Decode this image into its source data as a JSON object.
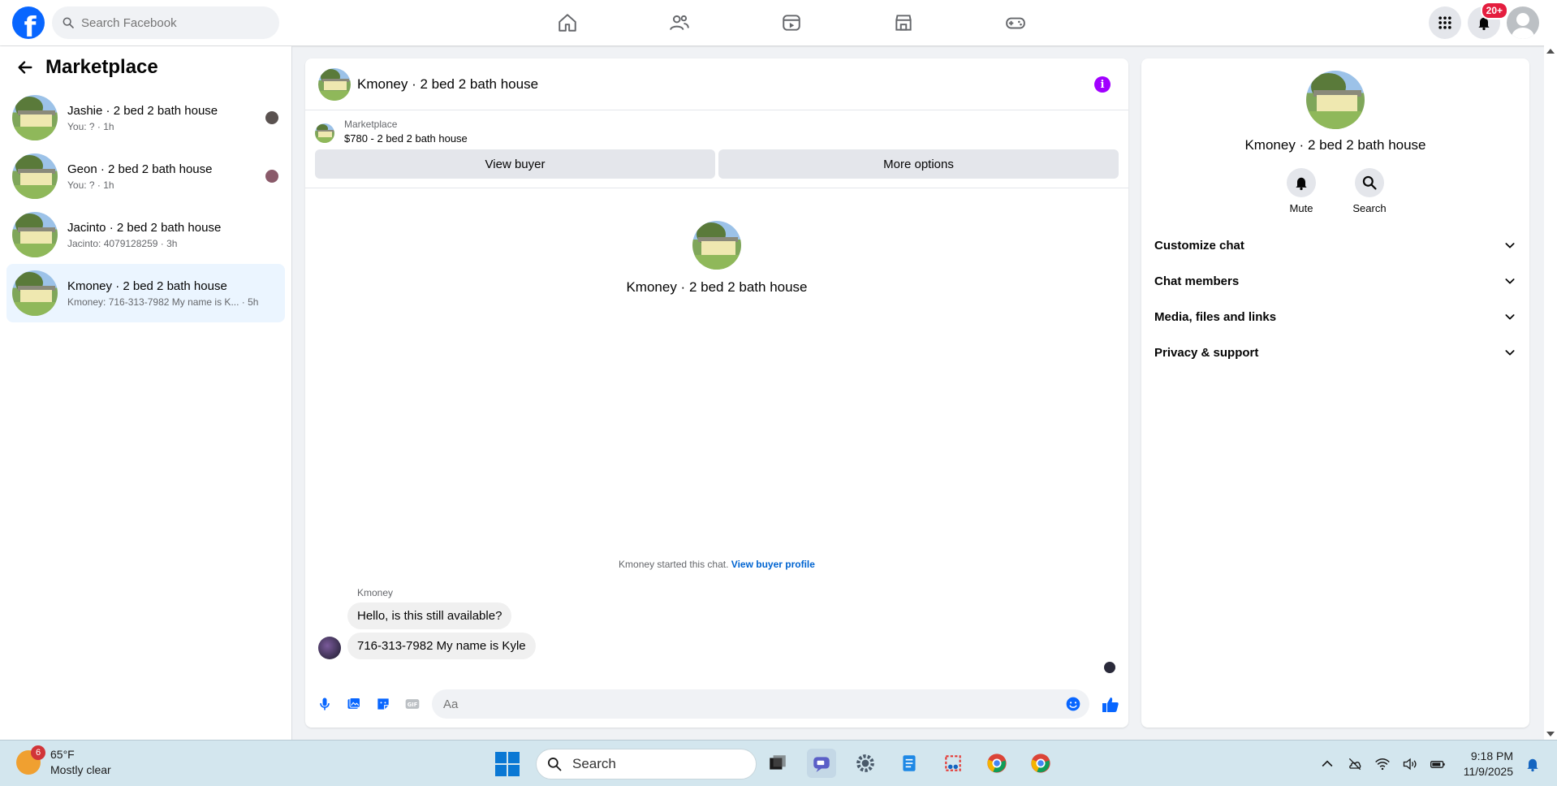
{
  "topbar": {
    "search_placeholder": "Search Facebook",
    "notification_badge": "20+"
  },
  "sidebar": {
    "title": "Marketplace",
    "conversations": [
      {
        "name": "Jashie · 2 bed 2 bath house",
        "sub": "You: ? · 1h",
        "active": false
      },
      {
        "name": "Geon · 2 bed 2 bath house",
        "sub": "You: ? · 1h",
        "active": false
      },
      {
        "name": "Jacinto · 2 bed 2 bath house",
        "sub": "Jacinto: 4079128259 · 3h",
        "active": false
      },
      {
        "name": "Kmoney · 2 bed 2 bath house",
        "sub": "Kmoney: 716-313-7982 My name is K... · 5h",
        "active": true
      }
    ]
  },
  "chat": {
    "title": "Kmoney · 2 bed 2 bath house",
    "listing": {
      "label": "Marketplace",
      "price_title": "$780 - 2 bed 2 bath house"
    },
    "buttons": {
      "view_buyer": "View buyer",
      "more_options": "More options"
    },
    "hero_name": "Kmoney · 2 bed 2 bath house",
    "started_text": "Kmoney started this chat.",
    "started_link": "View buyer profile",
    "sender": "Kmoney",
    "messages": [
      "Hello, is this still available?",
      "716-313-7982 My name is Kyle"
    ],
    "composer_placeholder": "Aa"
  },
  "info_panel": {
    "name": "Kmoney · 2 bed 2 bath house",
    "actions": {
      "mute": "Mute",
      "search": "Search"
    },
    "sections": [
      "Customize chat",
      "Chat members",
      "Media, files and links",
      "Privacy & support"
    ]
  },
  "taskbar": {
    "weather_badge": "6",
    "temperature": "65°F",
    "condition": "Mostly clear",
    "search_label": "Search",
    "time": "9:18 PM",
    "date": "11/9/2025"
  },
  "colors": {
    "brand": "#0866ff",
    "info_accent": "#a100ff",
    "active_row": "#ebf5ff",
    "link": "#0064d1"
  }
}
